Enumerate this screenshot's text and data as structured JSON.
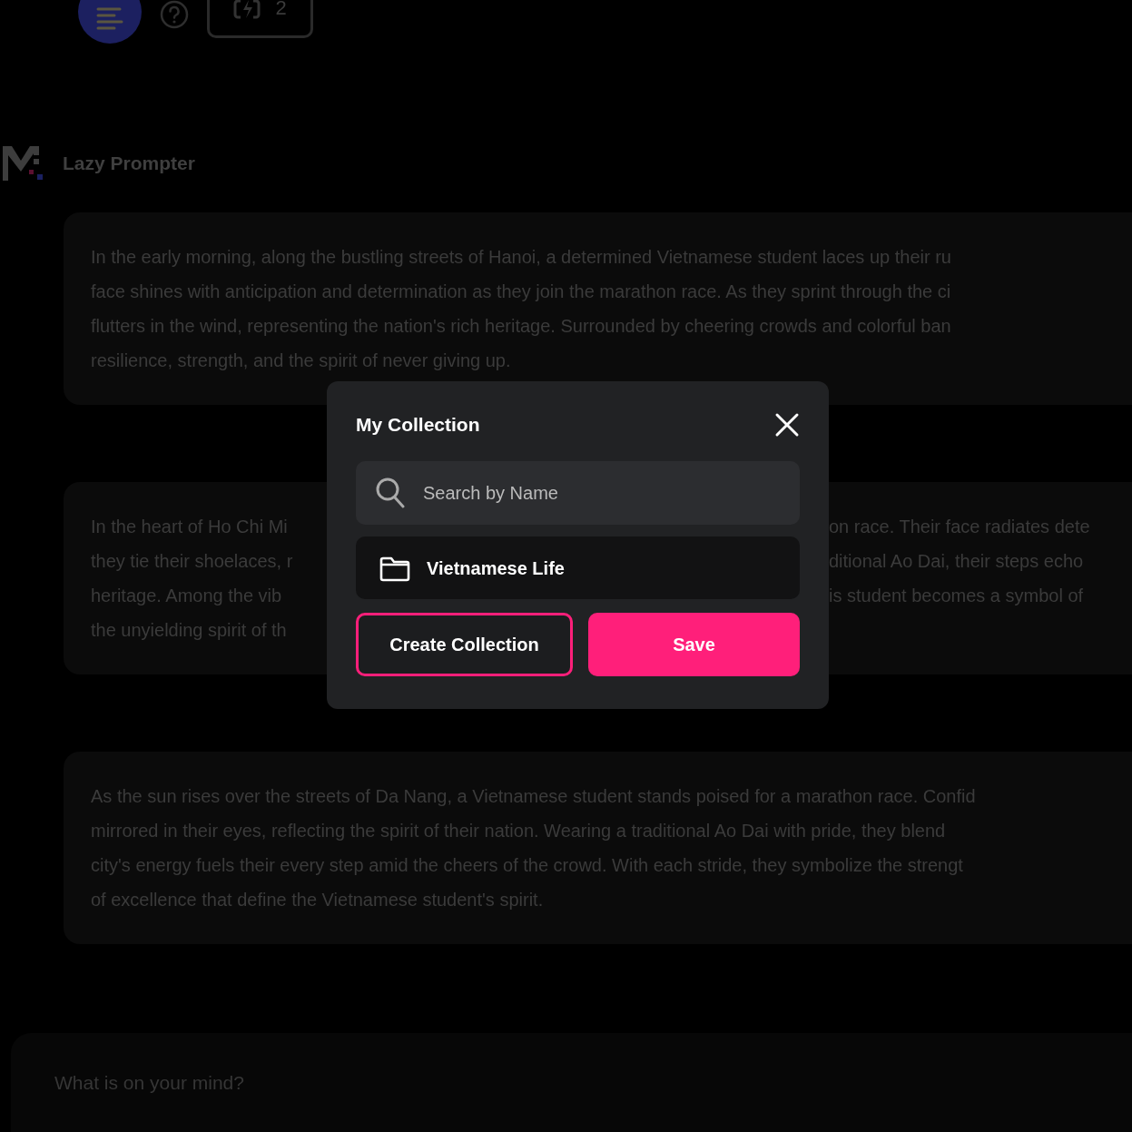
{
  "topbar": {
    "credits": "2"
  },
  "brand": {
    "name": "Lazy Prompter"
  },
  "prompts": [
    {
      "kind": "full",
      "lines": [
        "In the early morning, along the bustling streets of Hanoi, a determined Vietnamese student laces up their ru",
        "face shines with anticipation and determination as they join the marathon race. As they sprint through the ci",
        "flutters in the wind, representing the nation's rich heritage. Surrounded by cheering crowds and colorful ban",
        "resilience, strength, and the spirit of never giving up."
      ]
    },
    {
      "kind": "split",
      "lines": [
        {
          "left": "In the heart of Ho Chi Mi",
          "right": "on race. Their face radiates dete"
        },
        {
          "left": "they tie their shoelaces, r",
          "right": "ditional Ao Dai, their steps echo"
        },
        {
          "left": "heritage. Among the vib",
          "right": "is student becomes a symbol of"
        },
        {
          "left": "the unyielding spirit of th"
        }
      ]
    },
    {
      "kind": "full",
      "lines": [
        "As the sun rises over the streets of Da Nang, a Vietnamese student stands poised for a marathon race. Confid",
        "mirrored in their eyes, reflecting the spirit of their nation. Wearing a traditional Ao Dai with pride, they blend",
        "city's energy fuels their every step amid the cheers of the crowd. With each stride, they symbolize the strengt",
        "of excellence that define the Vietnamese student's spirit."
      ]
    }
  ],
  "composer": {
    "placeholder": "What is on your mind?"
  },
  "modal": {
    "title": "My Collection",
    "search": {
      "placeholder": "Search by Name"
    },
    "collections": [
      {
        "name": "Vietnamese Life"
      }
    ],
    "buttons": {
      "create": "Create Collection",
      "save": "Save"
    }
  }
}
